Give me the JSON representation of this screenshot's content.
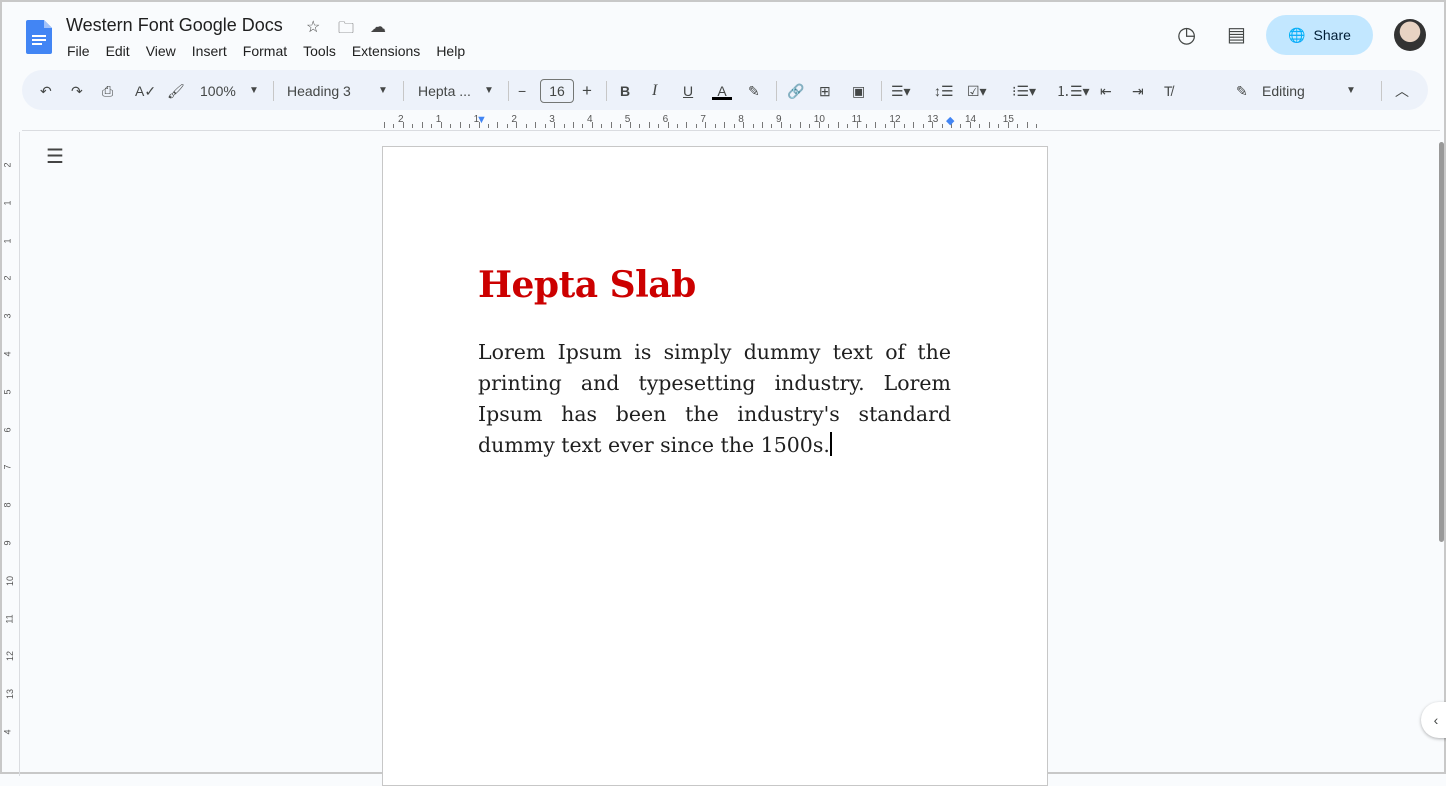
{
  "app": {
    "title": "Western Font Google Docs",
    "accent": "#1a73e8"
  },
  "menu": [
    "File",
    "Edit",
    "View",
    "Insert",
    "Format",
    "Tools",
    "Extensions",
    "Help"
  ],
  "header": {
    "share_label": "Share"
  },
  "toolbar": {
    "zoom": "100%",
    "style": "Heading 3",
    "font": "Hepta ...",
    "font_size": "16",
    "mode": "Editing"
  },
  "ruler": {
    "h": [
      "2",
      "1",
      "1",
      "2",
      "3",
      "4",
      "5",
      "6",
      "7",
      "8",
      "9",
      "10",
      "11",
      "12",
      "13",
      "14",
      "15"
    ],
    "v": [
      "2",
      "1",
      "1",
      "2",
      "3",
      "4",
      "5",
      "6",
      "7",
      "8",
      "9",
      "10",
      "11",
      "12",
      "13",
      "4"
    ]
  },
  "document": {
    "heading": "Hepta Slab",
    "heading_color": "#cc0000",
    "body": "Lorem Ipsum is simply dummy text of the printing and typesetting industry. Lorem Ipsum has been the industry's standard dummy text ever since the 1500s."
  }
}
